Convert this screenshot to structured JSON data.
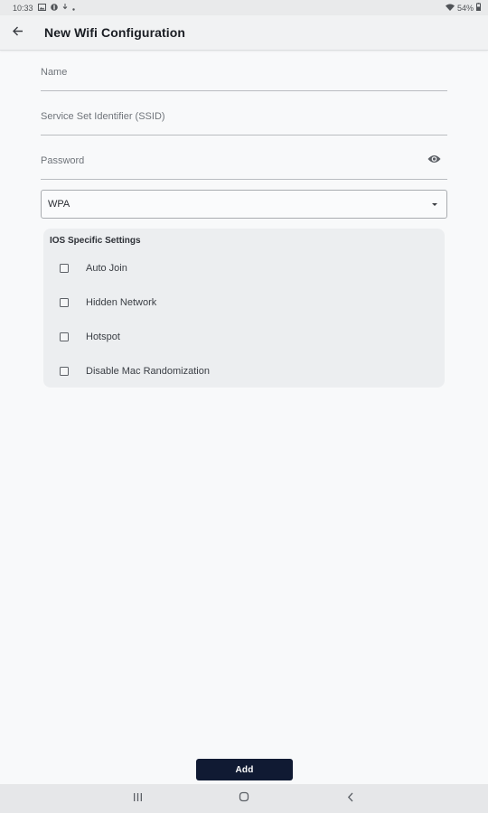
{
  "status_bar": {
    "time": "10:33",
    "battery": "54%"
  },
  "app_bar": {
    "title": "New Wifi Configuration",
    "back_icon": "arrow-left-icon"
  },
  "form": {
    "name_placeholder": "Name",
    "ssid_placeholder": "Service Set Identifier (SSID)",
    "password_placeholder": "Password",
    "password_toggle_icon": "eye-icon",
    "security_selected": "WPA"
  },
  "ios_settings": {
    "title": "IOS Specific Settings",
    "options": [
      {
        "label": "Auto Join",
        "checked": false
      },
      {
        "label": "Hidden Network",
        "checked": false
      },
      {
        "label": "Hotspot",
        "checked": false
      },
      {
        "label": "Disable Mac Randomization",
        "checked": false
      }
    ]
  },
  "actions": {
    "add_label": "Add"
  },
  "colors": {
    "primary": "#101a33",
    "background": "#f8f9fa",
    "card": "#eceef0"
  }
}
